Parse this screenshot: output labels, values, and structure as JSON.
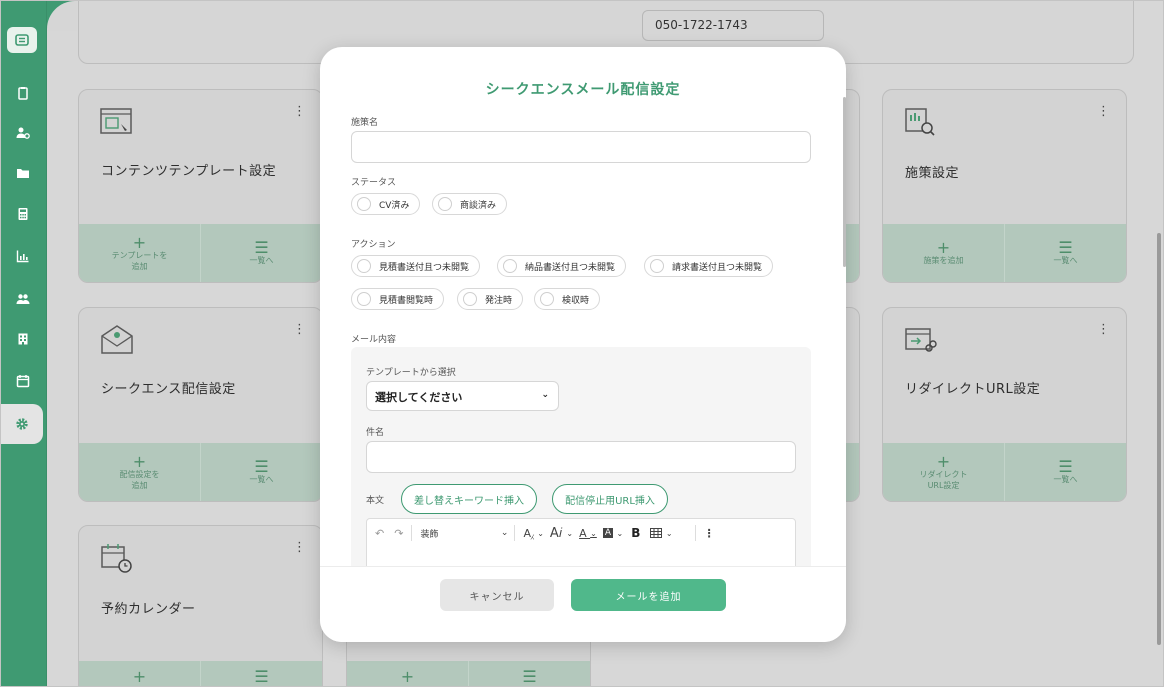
{
  "top_card": {
    "phone": "050-1722-1743"
  },
  "cards": [
    {
      "title": "コンテンツテンプレート設定",
      "icon": "template-icon",
      "add_label": "テンプレートを\n追加",
      "list_label": "一覧へ"
    },
    {
      "title": "施策設定",
      "icon": "chart-search-icon",
      "add_label": "施策を追加",
      "list_label": "一覧へ"
    },
    {
      "title": "シークエンス配信設定",
      "icon": "mail-icon",
      "add_label": "配信設定を\n追加",
      "list_label": "一覧へ"
    },
    {
      "title": "リダイレクトURL設定",
      "icon": "redirect-link-icon",
      "add_label": "リダイレクト\nURL設定",
      "list_label": "一覧へ"
    },
    {
      "title": "予約カレンダー",
      "icon": "calendar-clock-icon",
      "add_label": "",
      "list_label": ""
    }
  ],
  "footer_symbols": {
    "add": "+",
    "list": "☰"
  },
  "kebab": "⋮",
  "modal": {
    "title": "シークエンスメール配信設定",
    "policy_label": "施策名",
    "policy_value": "",
    "status_label": "ステータス",
    "status_options": [
      "CV済み",
      "商談済み"
    ],
    "action_label": "アクション",
    "action_options_row1": [
      "見積書送付且つ未開覧",
      "納品書送付且つ未開覧",
      "請求書送付且つ未開覧"
    ],
    "action_options_row2": [
      "見積書閲覧時",
      "発注時",
      "検収時"
    ],
    "mail_label": "メール内容",
    "template_label": "テンプレートから選択",
    "template_select": "選択してください",
    "subject_label": "件名",
    "subject_value": "",
    "body_label": "本文",
    "insert_keyword_button": "差し替えキーワード挿入",
    "insert_unsubscribe_button": "配信停止用URL挿入",
    "toolbar": {
      "undo": "↶",
      "redo": "↷",
      "style_select": "装飾",
      "bold": "B"
    },
    "cancel_button": "キャンセル",
    "add_button": "メールを追加"
  },
  "colors": {
    "brand": "#3f9a72",
    "accent_button": "#50b88b",
    "overlay": "#d6d6d6"
  }
}
